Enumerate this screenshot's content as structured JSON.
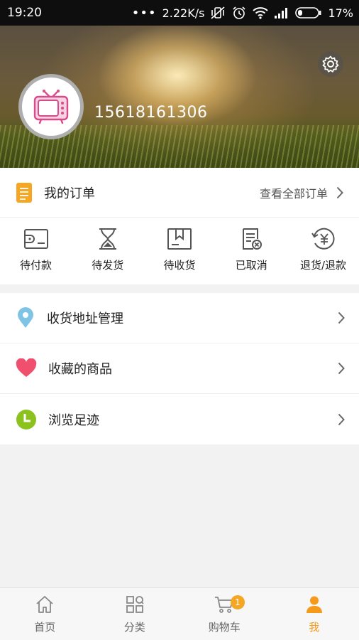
{
  "status_bar": {
    "time": "19:20",
    "net_speed": "2.22K/s",
    "battery": "17%"
  },
  "profile": {
    "phone": "15618161306",
    "avatar_icon": "tv-icon",
    "settings_icon": "gear-icon"
  },
  "orders": {
    "title": "我的订单",
    "view_all": "查看全部订单",
    "statuses": [
      {
        "label": "待付款",
        "icon": "wallet-icon"
      },
      {
        "label": "待发货",
        "icon": "hourglass-icon"
      },
      {
        "label": "待收货",
        "icon": "package-icon"
      },
      {
        "label": "已取消",
        "icon": "cancelled-receipt-icon"
      },
      {
        "label": "退货/退款",
        "icon": "refund-yen-icon"
      }
    ]
  },
  "menu": [
    {
      "label": "收货地址管理",
      "icon": "location-pin-icon",
      "color": "#7fc4e4"
    },
    {
      "label": "收藏的商品",
      "icon": "heart-icon",
      "color": "#f0506e"
    },
    {
      "label": "浏览足迹",
      "icon": "clock-icon",
      "color": "#8cc21e"
    }
  ],
  "bottom_nav": {
    "items": [
      {
        "label": "首页",
        "icon": "home-icon"
      },
      {
        "label": "分类",
        "icon": "category-icon"
      },
      {
        "label": "购物车",
        "icon": "cart-icon",
        "badge": "1"
      },
      {
        "label": "我",
        "icon": "user-icon",
        "active": true
      }
    ]
  },
  "colors": {
    "accent": "#f59a1a",
    "order_icon": "#f5a623"
  }
}
